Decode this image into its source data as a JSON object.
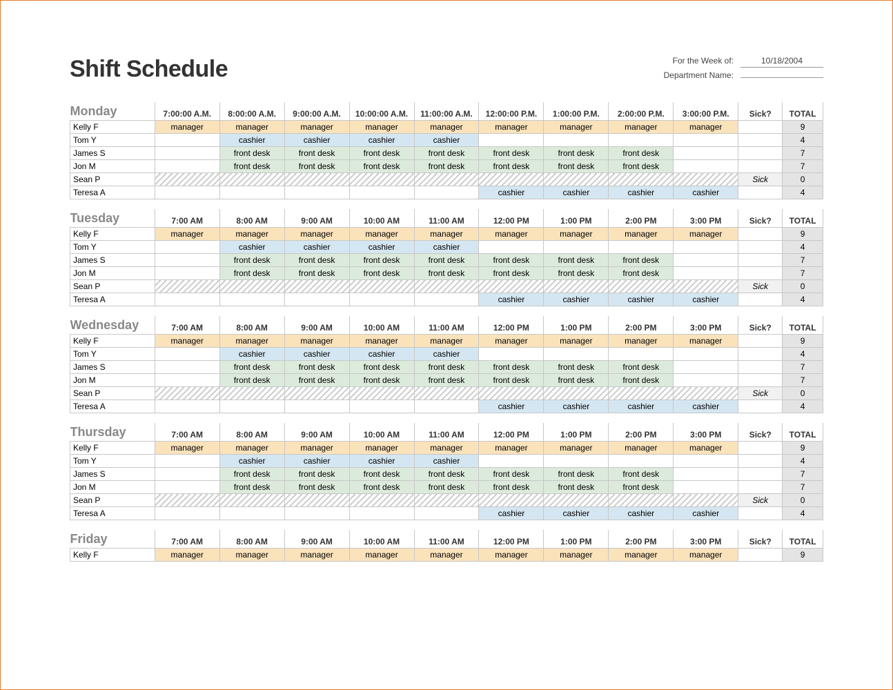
{
  "header": {
    "title": "Shift Schedule",
    "week_label": "For the Week of:",
    "week_value": "10/18/2004",
    "dept_label": "Department Name:",
    "dept_value": ""
  },
  "sick_header": "Sick?",
  "total_header": "TOTAL",
  "sick_value": "Sick",
  "days": [
    {
      "name": "Monday",
      "times": [
        "7:00:00 A.M.",
        "8:00:00 A.M.",
        "9:00:00 A.M.",
        "10:00:00 A.M.",
        "11:00:00 A.M.",
        "12:00:00 P.M.",
        "1:00:00 P.M.",
        "2:00:00 P.M.",
        "3:00:00 P.M."
      ],
      "rows": [
        {
          "name": "Kelly F",
          "slots": [
            "manager",
            "manager",
            "manager",
            "manager",
            "manager",
            "manager",
            "manager",
            "manager",
            "manager"
          ],
          "sick": false,
          "total": 9
        },
        {
          "name": "Tom Y",
          "slots": [
            "",
            "cashier",
            "cashier",
            "cashier",
            "cashier",
            "",
            "",
            "",
            ""
          ],
          "sick": false,
          "total": 4
        },
        {
          "name": "James S",
          "slots": [
            "",
            "front desk",
            "front desk",
            "front desk",
            "front desk",
            "front desk",
            "front desk",
            "front desk",
            ""
          ],
          "sick": false,
          "total": 7
        },
        {
          "name": "Jon M",
          "slots": [
            "",
            "front desk",
            "front desk",
            "front desk",
            "front desk",
            "front desk",
            "front desk",
            "front desk",
            ""
          ],
          "sick": false,
          "total": 7
        },
        {
          "name": "Sean P",
          "slots": [
            "",
            "",
            "",
            "",
            "",
            "",
            "",
            "",
            ""
          ],
          "sick": true,
          "total": 0
        },
        {
          "name": "Teresa A",
          "slots": [
            "",
            "",
            "",
            "",
            "",
            "cashier",
            "cashier",
            "cashier",
            "cashier"
          ],
          "sick": false,
          "total": 4
        }
      ]
    },
    {
      "name": "Tuesday",
      "times": [
        "7:00 AM",
        "8:00 AM",
        "9:00 AM",
        "10:00 AM",
        "11:00 AM",
        "12:00 PM",
        "1:00 PM",
        "2:00 PM",
        "3:00 PM"
      ],
      "rows": [
        {
          "name": "Kelly F",
          "slots": [
            "manager",
            "manager",
            "manager",
            "manager",
            "manager",
            "manager",
            "manager",
            "manager",
            "manager"
          ],
          "sick": false,
          "total": 9
        },
        {
          "name": "Tom Y",
          "slots": [
            "",
            "cashier",
            "cashier",
            "cashier",
            "cashier",
            "",
            "",
            "",
            ""
          ],
          "sick": false,
          "total": 4
        },
        {
          "name": "James S",
          "slots": [
            "",
            "front desk",
            "front desk",
            "front desk",
            "front desk",
            "front desk",
            "front desk",
            "front desk",
            ""
          ],
          "sick": false,
          "total": 7
        },
        {
          "name": "Jon M",
          "slots": [
            "",
            "front desk",
            "front desk",
            "front desk",
            "front desk",
            "front desk",
            "front desk",
            "front desk",
            ""
          ],
          "sick": false,
          "total": 7
        },
        {
          "name": "Sean P",
          "slots": [
            "",
            "",
            "",
            "",
            "",
            "",
            "",
            "",
            ""
          ],
          "sick": true,
          "total": 0
        },
        {
          "name": "Teresa A",
          "slots": [
            "",
            "",
            "",
            "",
            "",
            "cashier",
            "cashier",
            "cashier",
            "cashier"
          ],
          "sick": false,
          "total": 4
        }
      ]
    },
    {
      "name": "Wednesday",
      "times": [
        "7:00 AM",
        "8:00 AM",
        "9:00 AM",
        "10:00 AM",
        "11:00 AM",
        "12:00 PM",
        "1:00 PM",
        "2:00 PM",
        "3:00 PM"
      ],
      "rows": [
        {
          "name": "Kelly F",
          "slots": [
            "manager",
            "manager",
            "manager",
            "manager",
            "manager",
            "manager",
            "manager",
            "manager",
            "manager"
          ],
          "sick": false,
          "total": 9
        },
        {
          "name": "Tom Y",
          "slots": [
            "",
            "cashier",
            "cashier",
            "cashier",
            "cashier",
            "",
            "",
            "",
            ""
          ],
          "sick": false,
          "total": 4
        },
        {
          "name": "James S",
          "slots": [
            "",
            "front desk",
            "front desk",
            "front desk",
            "front desk",
            "front desk",
            "front desk",
            "front desk",
            ""
          ],
          "sick": false,
          "total": 7
        },
        {
          "name": "Jon M",
          "slots": [
            "",
            "front desk",
            "front desk",
            "front desk",
            "front desk",
            "front desk",
            "front desk",
            "front desk",
            ""
          ],
          "sick": false,
          "total": 7
        },
        {
          "name": "Sean P",
          "slots": [
            "",
            "",
            "",
            "",
            "",
            "",
            "",
            "",
            ""
          ],
          "sick": true,
          "total": 0
        },
        {
          "name": "Teresa A",
          "slots": [
            "",
            "",
            "",
            "",
            "",
            "cashier",
            "cashier",
            "cashier",
            "cashier"
          ],
          "sick": false,
          "total": 4
        }
      ]
    },
    {
      "name": "Thursday",
      "times": [
        "7:00 AM",
        "8:00 AM",
        "9:00 AM",
        "10:00 AM",
        "11:00 AM",
        "12:00 PM",
        "1:00 PM",
        "2:00 PM",
        "3:00 PM"
      ],
      "rows": [
        {
          "name": "Kelly F",
          "slots": [
            "manager",
            "manager",
            "manager",
            "manager",
            "manager",
            "manager",
            "manager",
            "manager",
            "manager"
          ],
          "sick": false,
          "total": 9
        },
        {
          "name": "Tom Y",
          "slots": [
            "",
            "cashier",
            "cashier",
            "cashier",
            "cashier",
            "",
            "",
            "",
            ""
          ],
          "sick": false,
          "total": 4
        },
        {
          "name": "James S",
          "slots": [
            "",
            "front desk",
            "front desk",
            "front desk",
            "front desk",
            "front desk",
            "front desk",
            "front desk",
            ""
          ],
          "sick": false,
          "total": 7
        },
        {
          "name": "Jon M",
          "slots": [
            "",
            "front desk",
            "front desk",
            "front desk",
            "front desk",
            "front desk",
            "front desk",
            "front desk",
            ""
          ],
          "sick": false,
          "total": 7
        },
        {
          "name": "Sean P",
          "slots": [
            "",
            "",
            "",
            "",
            "",
            "",
            "",
            "",
            ""
          ],
          "sick": true,
          "total": 0
        },
        {
          "name": "Teresa A",
          "slots": [
            "",
            "",
            "",
            "",
            "",
            "cashier",
            "cashier",
            "cashier",
            "cashier"
          ],
          "sick": false,
          "total": 4
        }
      ]
    },
    {
      "name": "Friday",
      "times": [
        "7:00 AM",
        "8:00 AM",
        "9:00 AM",
        "10:00 AM",
        "11:00 AM",
        "12:00 PM",
        "1:00 PM",
        "2:00 PM",
        "3:00 PM"
      ],
      "rows": [
        {
          "name": "Kelly F",
          "slots": [
            "manager",
            "manager",
            "manager",
            "manager",
            "manager",
            "manager",
            "manager",
            "manager",
            "manager"
          ],
          "sick": false,
          "total": 9
        }
      ]
    }
  ]
}
